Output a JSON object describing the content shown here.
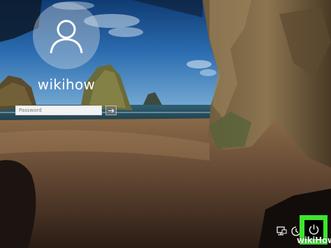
{
  "user": {
    "name": "wikihow",
    "avatar_icon": "user-silhouette-icon"
  },
  "login": {
    "password_placeholder": "Password",
    "password_value": "",
    "submit_icon": "arrow-right-icon"
  },
  "tray": {
    "network_icon": "network-icon",
    "accessibility_icon": "ease-of-access-icon",
    "power_icon": "power-icon",
    "highlight_color": "#3ee52f"
  },
  "watermark": {
    "text": "wikiHow"
  }
}
